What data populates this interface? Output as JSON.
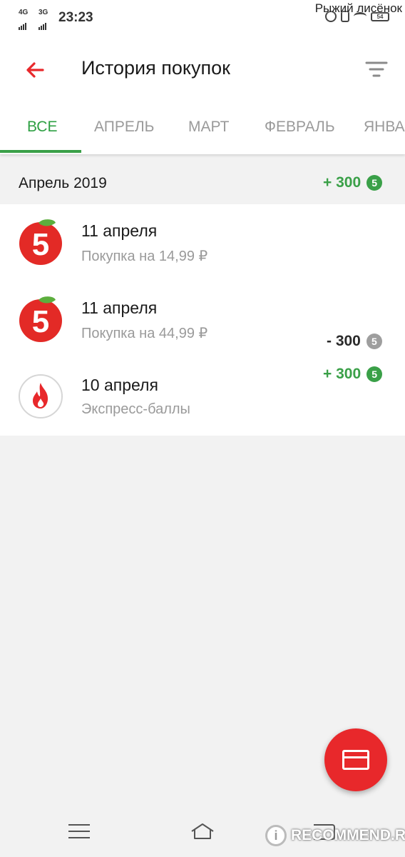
{
  "status_bar": {
    "net1": "4G",
    "net2": "3G",
    "time": "23:23",
    "battery": "54"
  },
  "watermark_top": "Рыжий лисёнок",
  "app_bar": {
    "title": "История покупок",
    "back_icon": "arrow-left-icon",
    "filter_icon": "filter-icon"
  },
  "tabs": [
    {
      "label": "ВСЕ",
      "active": true
    },
    {
      "label": "АПРЕЛЬ",
      "active": false
    },
    {
      "label": "МАРТ",
      "active": false
    },
    {
      "label": "ФЕВРАЛЬ",
      "active": false
    },
    {
      "label": "ЯНВА",
      "active": false
    }
  ],
  "month": {
    "title": "Апрель 2019",
    "points": "+ 300",
    "coin": "5"
  },
  "items": [
    {
      "date": "11 апреля",
      "subtitle": "Покупка на 14,99 ₽",
      "points": "",
      "logo": "pyaterochka-logo-icon"
    },
    {
      "date": "11 апреля",
      "subtitle": "Покупка на 44,99 ₽",
      "points": "- 300",
      "coin": "5",
      "logo": "pyaterochka-logo-icon"
    },
    {
      "date": "10 апреля",
      "subtitle": "Экспресс-баллы",
      "points": "+ 300",
      "coin": "5",
      "logo": "fire-icon"
    }
  ],
  "watermark_bottom": "RECOMMEND.RU",
  "watermark_badge": "i",
  "colors": {
    "accent_green": "#3aa048",
    "brand_red": "#e8282b",
    "muted_grey": "#9a9a9a"
  }
}
